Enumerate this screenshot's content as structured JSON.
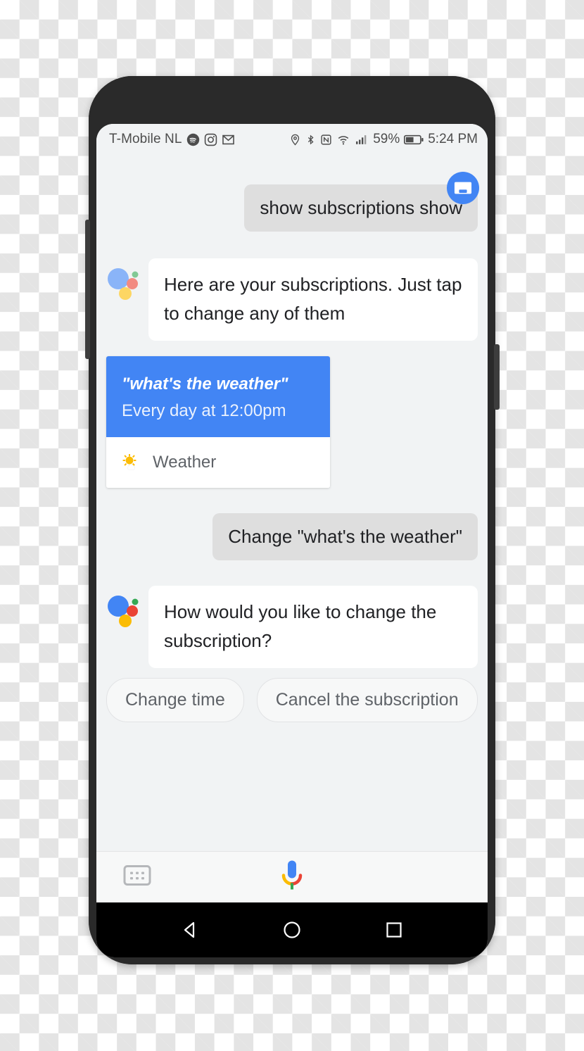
{
  "status_bar": {
    "carrier": "T-Mobile  NL",
    "left_icons": [
      "spotify-icon",
      "instagram-icon",
      "gmail-icon"
    ],
    "right_icons": [
      "location-icon",
      "bluetooth-icon",
      "nfc-icon",
      "wifi-icon",
      "signal-icon"
    ],
    "battery_percent": "59%",
    "battery_icon": "battery-icon",
    "clock": "5:24 PM"
  },
  "conversation": {
    "messages": [
      {
        "role": "user",
        "text": "show subscriptions show",
        "avatar_icon": "keyboard-input-avatar-icon"
      },
      {
        "role": "assistant",
        "text": "Here are your subscriptions. Just tap to change any of them",
        "logo_icon": "google-assistant-logo-icon"
      },
      {
        "role": "user",
        "text": "Change \"what's the weather\""
      },
      {
        "role": "assistant",
        "text": "How would you like to change the subscription?",
        "logo_icon": "google-assistant-logo-icon"
      }
    ]
  },
  "subscription_card": {
    "query": "\"what's the weather\"",
    "schedule": "Every day at 12:00pm",
    "app_label": "Weather",
    "app_icon": "partly-cloudy-weather-icon",
    "header_color": "#4285f4"
  },
  "suggestion_chips": [
    {
      "label": "Change time"
    },
    {
      "label": "Cancel the subscription"
    }
  ],
  "input_bar": {
    "keyboard_icon": "keyboard-icon",
    "mic_icon": "google-microphone-icon"
  },
  "nav_bar": {
    "back_icon": "back-triangle-icon",
    "home_icon": "home-circle-icon",
    "recents_icon": "recents-square-icon"
  },
  "colors": {
    "accent_blue": "#4285f4",
    "google_red": "#ea4335",
    "google_yellow": "#fbbc05",
    "google_green": "#34a853",
    "screen_bg": "#f1f3f4",
    "user_bubble": "#dedede"
  }
}
